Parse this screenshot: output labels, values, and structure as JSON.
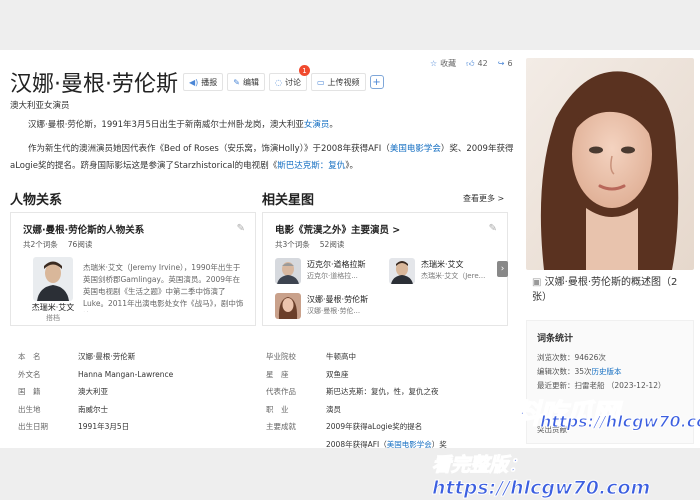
{
  "title": "汉娜·曼根·劳伦斯",
  "actions": [
    {
      "label": "播报",
      "icon": "speaker-icon"
    },
    {
      "label": "编辑",
      "icon": "pen-icon"
    },
    {
      "label": "讨论",
      "icon": "chat-icon",
      "badge": "1"
    },
    {
      "label": "上传视频",
      "icon": "video-icon"
    }
  ],
  "top_right": {
    "collect": "收藏",
    "likes": "42",
    "shares": "6"
  },
  "subtitle": "澳大利亚女演员",
  "intro1": {
    "pre": "汉娜·曼根·劳伦斯，1991年3月5日出生于新南威尔士州卧龙岗，澳大利亚",
    "link": "女演员",
    "post": "。"
  },
  "intro2": {
    "pre": "作为新生代的澳洲演员她因代表作《Bed of Roses（安乐窝，饰演Holly）》于2008年获得AFI（",
    "link1": "美国电影学会",
    "mid": "）奖、2009年获得aLogie奖的提名。跻身国际影坛这是参演了Starzhistorical的电视剧《",
    "link2": "斯巴达克斯：复仇",
    "post": "》。"
  },
  "relations": {
    "heading": "人物关系",
    "card_title": "汉娜·曼根·劳伦斯的人物关系",
    "meta1": "共2个词条",
    "meta2": "76阅读",
    "person_name": "杰瑞米·艾文",
    "person_role": "搭档",
    "desc": "杰瑞米·艾文（Jeremy Irvine），1990年出生于英国剑桥郡Gamlingay。英国演员。2009年在英国电视剧《生活之题》中第二季中饰演了Luke。2011年出演电影处女作《战马》，剧中饰演..."
  },
  "stars": {
    "heading": "相关星图",
    "see_more": "查看更多 >",
    "card_title": "电影《荒漠之外》主要演员 >",
    "meta1": "共3个词条",
    "meta2": "52阅读",
    "people": [
      {
        "name": "迈克尔·道格拉斯",
        "sub": "迈克尔·道格拉..."
      },
      {
        "name": "杰瑞米·艾文",
        "sub": "杰瑞米·艾文（Jere..."
      },
      {
        "name": "汉娜·曼根·劳伦斯",
        "sub": "汉娜·曼根·劳伦..."
      }
    ]
  },
  "info_left": [
    {
      "k": "本　名",
      "v": "汉娜·曼根·劳伦斯"
    },
    {
      "k": "外文名",
      "v": "Hanna Mangan-Lawrence"
    },
    {
      "k": "国　籍",
      "v": "澳大利亚",
      "link": true
    },
    {
      "k": "出生地",
      "v": "南威尔士"
    },
    {
      "k": "出生日期",
      "v": "1991年3月5日"
    }
  ],
  "info_right": [
    {
      "k": "毕业院校",
      "v": "牛顿高中"
    },
    {
      "k": "星　座",
      "v": "双鱼座",
      "link": true
    },
    {
      "k": "代表作品",
      "v": "斯巴达克斯：复仇，性，复仇之夜"
    },
    {
      "k": "职　业",
      "v": "演员"
    },
    {
      "k": "主要成就",
      "v": "2009年获得aLogie奖的提名"
    }
  ],
  "achievement2": {
    "pre": "2008年获得AFI（",
    "link": "美国电影学会",
    "post": "）奖"
  },
  "photo_caption": "汉娜·曼根·劳伦斯的概述图（2张）",
  "stats": {
    "title": "词条统计",
    "views_k": "浏览次数：",
    "views_v": "94626次",
    "edits_k": "编辑次数：",
    "edits_v": "35次",
    "edits_link": "历史版本",
    "updated_k": "最近更新：",
    "updated_v": "扫雷老船 （2023-12-12）",
    "creator_k": "突出贡献"
  },
  "watermark": {
    "line1": "黑料吃瓜网",
    "line2": "https://hlcgw70.com",
    "line3": "看完整版：https://hlcgw70.com"
  },
  "colors": {
    "link": "#136ec2",
    "badge": "#f04a2e",
    "watermark": "#3c5fe0"
  }
}
